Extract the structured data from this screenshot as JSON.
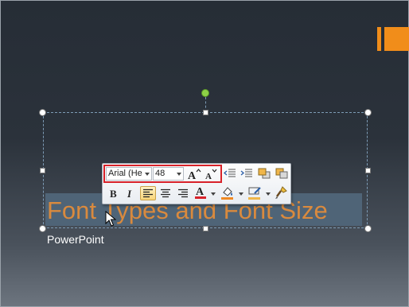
{
  "slide": {
    "title": "Font Types and Font Size",
    "caption": "PowerPoint"
  },
  "mini_toolbar": {
    "font_name": "Arial (He",
    "font_size": "48",
    "buttons": [
      "grow-font",
      "shrink-font",
      "decrease-indent",
      "increase-indent",
      "bring-forward",
      "send-backward",
      "bold",
      "italic",
      "align-left",
      "center",
      "align-right",
      "font-color",
      "shape-fill",
      "shape-outline",
      "format-painter"
    ]
  },
  "colors": {
    "accent": "#f18d1a",
    "title_text": "#d98a3e",
    "highlight_box": "#d8222a",
    "rotation_handle": "#8ed147"
  }
}
